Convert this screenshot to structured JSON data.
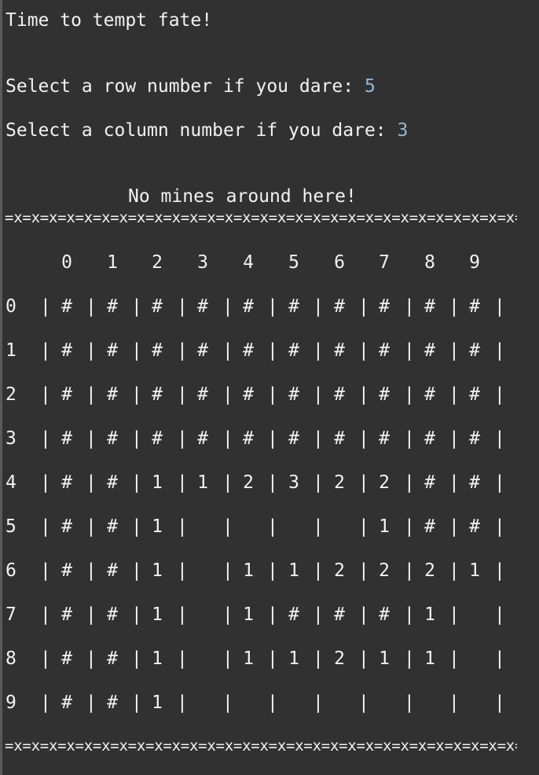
{
  "terminal": {
    "intro": "Time to tempt fate!",
    "row_prompt": "Select a row number if you dare: ",
    "row_value": "5",
    "col_prompt": "Select a column number if you dare: ",
    "col_value": "3",
    "message": "No mines around here!",
    "divider": "=x=x=x=x=x=x=x=x=x=x=x=x=x=x=x=x=x=x=x=x=x=x=x=x=x=x=x=x=x=x=x=x="
  },
  "board": {
    "column_headers": [
      "0",
      "1",
      "2",
      "3",
      "4",
      "5",
      "6",
      "7",
      "8",
      "9"
    ],
    "row_labels": [
      "0",
      "1",
      "2",
      "3",
      "4",
      "5",
      "6",
      "7",
      "8",
      "9"
    ],
    "cells": [
      [
        "#",
        "#",
        "#",
        "#",
        "#",
        "#",
        "#",
        "#",
        "#",
        "#"
      ],
      [
        "#",
        "#",
        "#",
        "#",
        "#",
        "#",
        "#",
        "#",
        "#",
        "#"
      ],
      [
        "#",
        "#",
        "#",
        "#",
        "#",
        "#",
        "#",
        "#",
        "#",
        "#"
      ],
      [
        "#",
        "#",
        "#",
        "#",
        "#",
        "#",
        "#",
        "#",
        "#",
        "#"
      ],
      [
        "#",
        "#",
        "1",
        "1",
        "2",
        "3",
        "2",
        "2",
        "#",
        "#"
      ],
      [
        "#",
        "#",
        "1",
        "",
        "",
        "",
        "",
        "1",
        "#",
        "#"
      ],
      [
        "#",
        "#",
        "1",
        "",
        "1",
        "1",
        "2",
        "2",
        "2",
        "1"
      ],
      [
        "#",
        "#",
        "1",
        "",
        "1",
        "#",
        "#",
        "#",
        "1",
        ""
      ],
      [
        "#",
        "#",
        "1",
        "",
        "1",
        "1",
        "2",
        "1",
        "1",
        ""
      ],
      [
        "#",
        "#",
        "1",
        "",
        "",
        "",
        "",
        "",
        "",
        ""
      ]
    ]
  }
}
